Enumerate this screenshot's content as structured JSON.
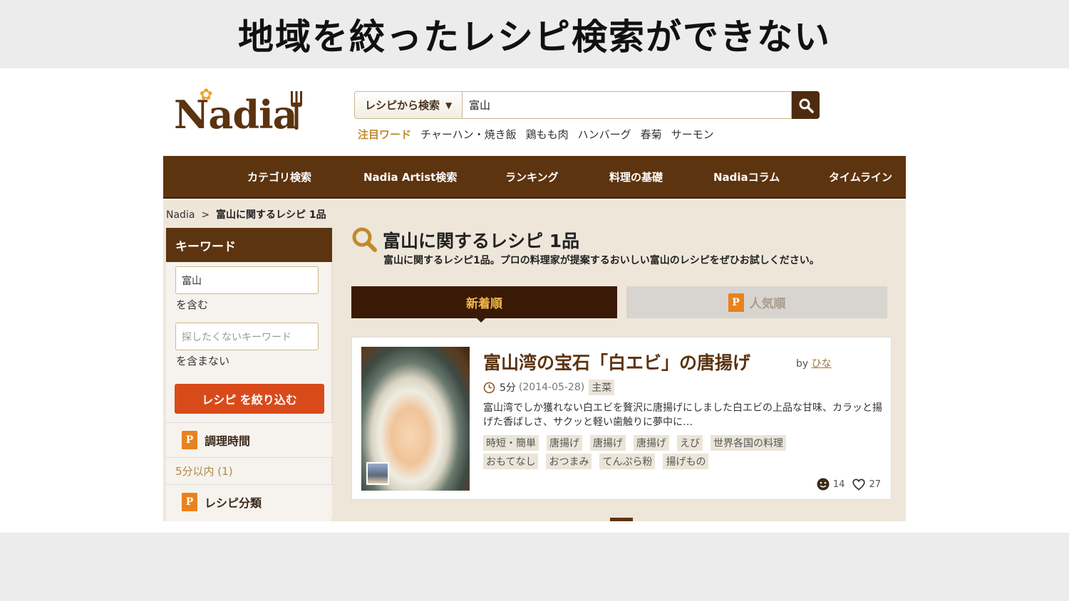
{
  "slide": {
    "title": "地域を絞ったレシピ検索ができない"
  },
  "header": {
    "logo_text": "Nadia",
    "search_scope": "レシピから検索",
    "search_value": "富山",
    "hot_label": "注目ワード",
    "hot_words": [
      "チャーハン・焼き飯",
      "鶏もも肉",
      "ハンバーグ",
      "春菊",
      "サーモン"
    ]
  },
  "nav": {
    "items": [
      "カテゴリ検索",
      "Nadia Artist検索",
      "ランキング",
      "料理の基礎",
      "Nadiaコラム",
      "タイムライン"
    ]
  },
  "breadcrumb": {
    "root": "Nadia",
    "separator": ">",
    "current": "富山に関するレシピ 1品"
  },
  "sidebar": {
    "heading": "キーワード",
    "include_value": "富山",
    "include_note": "を含む",
    "exclude_placeholder": "探したくないキーワード",
    "exclude_note": "を含まない",
    "refine_button": "レシピ を絞り込む",
    "section_time": "調理時間",
    "time_item": "5分以内 (1)",
    "section_category": "レシピ分類"
  },
  "main": {
    "title": "富山に関するレシピ 1品",
    "description": "富山に関するレシピ1品。プロの料理家が提案するおいしい富山のレシピをぜひお試しください。",
    "tab_new": "新着順",
    "tab_popular": "人気順"
  },
  "recipe": {
    "title": "富山湾の宝石「白エビ」の唐揚げ",
    "by_label": "by",
    "author": "ひな",
    "time": "5分",
    "date": "(2014-05-28)",
    "category": "主菜",
    "description": "富山湾でしか獲れない白エビを贅沢に唐揚げにしました白エビの上品な甘味、カラッと揚げた香ばしさ、サクッと軽い歯触りに夢中に…",
    "tags_row1": [
      "時短・簡単",
      "唐揚げ",
      "唐揚げ",
      "唐揚げ",
      "えび",
      "世界各国の料理"
    ],
    "tags_row2": [
      "おもてなし",
      "おつまみ",
      "てんぷら粉",
      "揚げもの"
    ],
    "tsukurepo_count": "14",
    "like_count": "27"
  },
  "icons": {
    "search": "search-icon",
    "clock": "clock-icon",
    "face": "face-icon",
    "heart": "heart-icon",
    "p_badge": "P"
  },
  "colors": {
    "brand_brown": "#5d3410",
    "accent_orange": "#e9821c",
    "refine_red": "#d94a1b",
    "tab_text_gold": "#f2b84b"
  }
}
